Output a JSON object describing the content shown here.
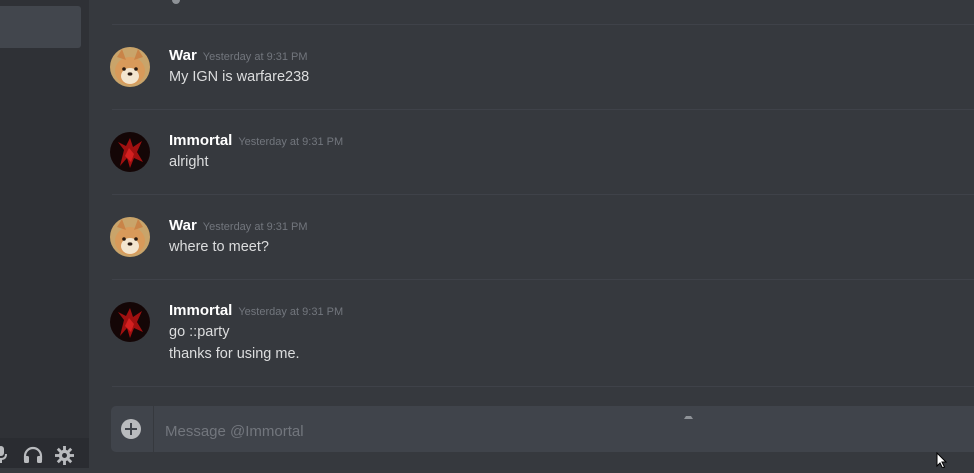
{
  "messages": [
    {
      "author": "War",
      "timestamp": "Yesterday at 9:31 PM",
      "lines": [
        "My IGN is warfare238"
      ],
      "avatar": "shiba-dog-avatar"
    },
    {
      "author": "Immortal",
      "timestamp": "Yesterday at 9:31 PM",
      "lines": [
        "alright"
      ],
      "avatar": "dark-red-creature-avatar"
    },
    {
      "author": "War",
      "timestamp": "Yesterday at 9:31 PM",
      "lines": [
        "where to meet?"
      ],
      "avatar": "shiba-dog-avatar"
    },
    {
      "author": "Immortal",
      "timestamp": "Yesterday at 9:31 PM",
      "lines": [
        "go ::party",
        "thanks for using me."
      ],
      "avatar": "dark-red-creature-avatar"
    }
  ],
  "composer": {
    "placeholder": "Message @Immortal",
    "value": ""
  },
  "user_panel": {
    "icons": [
      "microphone-icon",
      "headphones-icon",
      "gear-icon"
    ]
  },
  "colors": {
    "background": "#36393e",
    "sidebar": "#2f3136",
    "text": "#dcddde",
    "muted": "#72767d"
  }
}
